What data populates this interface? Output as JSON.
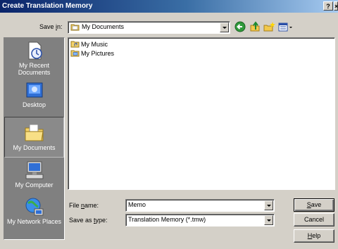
{
  "window": {
    "title": "Create Translation Memory",
    "help_btn": "?",
    "close_btn": "×"
  },
  "save_in": {
    "label_pre": "Save ",
    "label_key": "i",
    "label_post": "n:",
    "value": "My Documents"
  },
  "toolbar": {
    "icons": [
      "back-icon",
      "up-folder-icon",
      "new-folder-icon",
      "views-menu-icon"
    ]
  },
  "places": [
    {
      "name": "history",
      "label": "My Recent Documents",
      "icon": "recent-documents-icon"
    },
    {
      "name": "desktop",
      "label": "Desktop",
      "icon": "desktop-icon"
    },
    {
      "name": "my-documents",
      "label": "My Documents",
      "icon": "my-documents-icon",
      "selected": true
    },
    {
      "name": "my-computer",
      "label": "My Computer",
      "icon": "my-computer-icon"
    },
    {
      "name": "my-network",
      "label": "My Network Places",
      "icon": "network-places-icon"
    }
  ],
  "files": [
    {
      "name": "My Music",
      "icon": "music-folder-icon"
    },
    {
      "name": "My Pictures",
      "icon": "pictures-folder-icon"
    }
  ],
  "file_name": {
    "label_pre": "File ",
    "label_key": "n",
    "label_post": "ame:",
    "value": "Memo"
  },
  "save_as_type": {
    "label_pre": "Save as ",
    "label_key": "t",
    "label_post": "ype:",
    "value": "Translation Memory (*.tmw)"
  },
  "buttons": {
    "save_key": "S",
    "save_rest": "ave",
    "cancel": "Cancel",
    "help_key": "H",
    "help_rest": "elp"
  }
}
